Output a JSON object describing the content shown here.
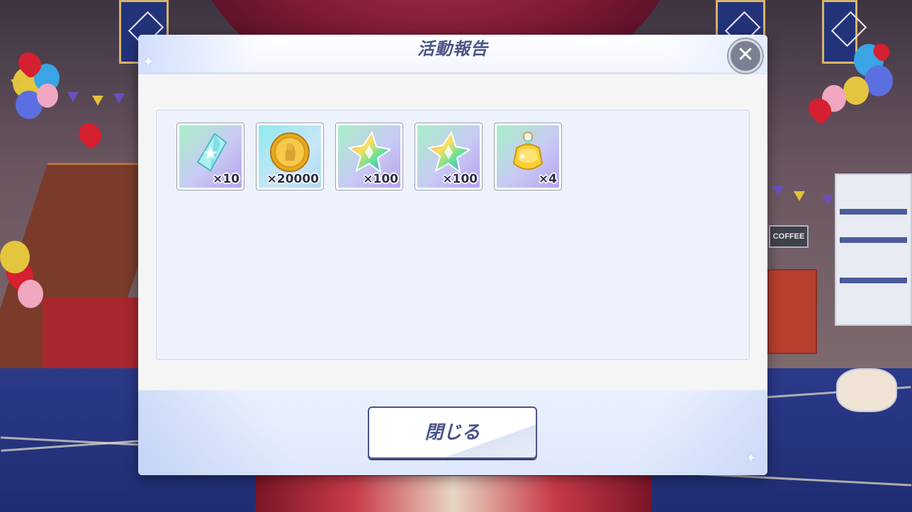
{
  "dialog": {
    "title": "活動報告",
    "close_icon_glyph": "✕",
    "close_button_label": "閉じる"
  },
  "background": {
    "sign_text": "COFFEE"
  },
  "items": [
    {
      "name": "crystal",
      "icon": "crystal-icon",
      "quantity": "×10"
    },
    {
      "name": "gold-coin",
      "icon": "coin-icon",
      "quantity": "×20000"
    },
    {
      "name": "rainbow-star",
      "icon": "star-icon",
      "quantity": "×100"
    },
    {
      "name": "rainbow-star",
      "icon": "star-icon",
      "quantity": "×100"
    },
    {
      "name": "potion-bottle",
      "icon": "potion-icon",
      "quantity": "×4"
    }
  ],
  "colors": {
    "title": "#4a5488",
    "panel": "#eef2fd",
    "accent": "#4a5488"
  }
}
